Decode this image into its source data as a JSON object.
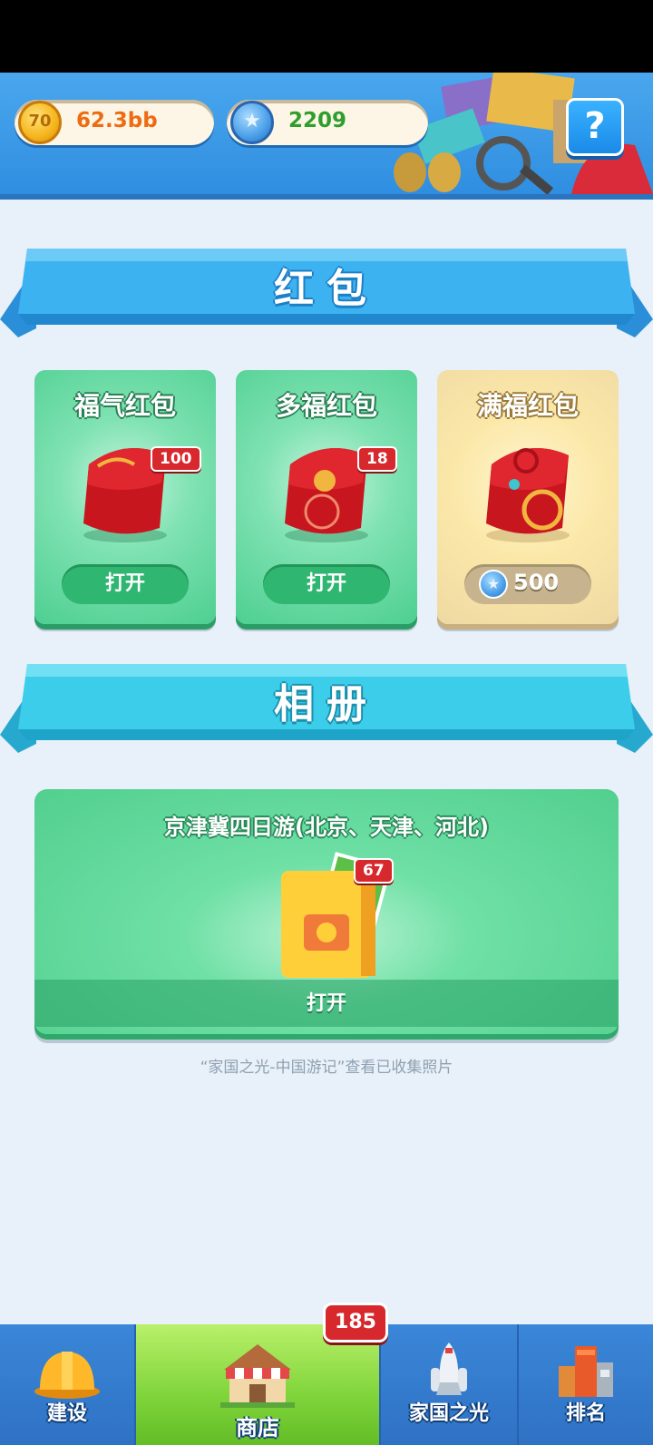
{
  "currencies": {
    "coins": "62.3bb",
    "coin_symbol": "70",
    "gems": "2209"
  },
  "help": {
    "label": "?"
  },
  "sections": {
    "red_packet_title": "红包",
    "album_title": "相册"
  },
  "red_packets": [
    {
      "title": "福气红包",
      "badge": "100",
      "action": "打开"
    },
    {
      "title": "多福红包",
      "badge": "18",
      "action": "打开"
    },
    {
      "title": "满福红包",
      "price": "500"
    }
  ],
  "album": {
    "title": "京津冀四日游(北京、天津、河北)",
    "badge": "67",
    "action": "打开",
    "hint": "“家国之光-中国游记”查看已收集照片"
  },
  "nav": {
    "items": [
      {
        "label": "建设"
      },
      {
        "label": "商店"
      },
      {
        "label": "家国之光"
      },
      {
        "label": "排名"
      }
    ],
    "shop_badge": "185"
  }
}
